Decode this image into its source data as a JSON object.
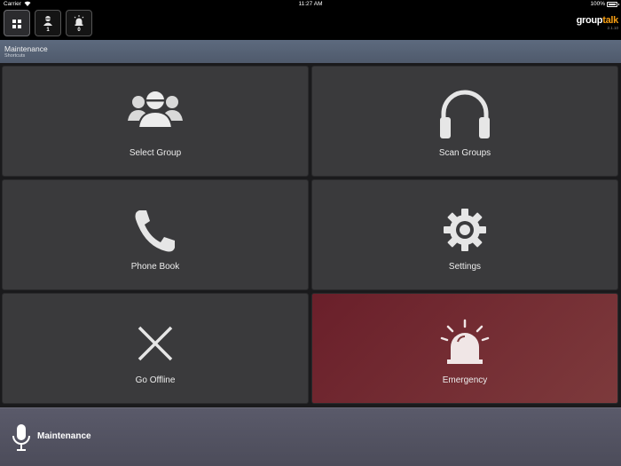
{
  "status_bar": {
    "carrier": "Carrier",
    "time": "11:27 AM",
    "battery": "100%"
  },
  "toolbar": {
    "buttons": [
      {
        "icon": "grid-icon",
        "count": ""
      },
      {
        "icon": "person-icon",
        "count": "1"
      },
      {
        "icon": "alarm-icon",
        "count": "0"
      }
    ]
  },
  "brand": {
    "logo_part1": "group",
    "logo_part2": "talk",
    "version": "2.1.10"
  },
  "breadcrumb": {
    "title": "Maintenance",
    "subtitle": "Shortcuts"
  },
  "shortcuts": [
    {
      "label": "Select Group",
      "icon": "group-icon"
    },
    {
      "label": "Scan Groups",
      "icon": "headphones-icon"
    },
    {
      "label": "Phone Book",
      "icon": "phone-icon"
    },
    {
      "label": "Settings",
      "icon": "gear-icon"
    },
    {
      "label": "Go Offline",
      "icon": "close-icon"
    },
    {
      "label": "Emergency",
      "icon": "emergency-light-icon"
    }
  ],
  "ptt": {
    "label": "Maintenance",
    "icon": "microphone-icon"
  },
  "colors": {
    "emergency": "#7d3a3c",
    "brand_accent": "#f39c12",
    "header": "#5d6a7e"
  }
}
